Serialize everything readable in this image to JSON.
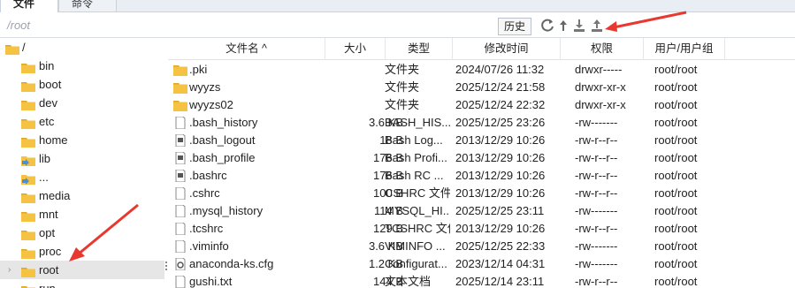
{
  "tabs": [
    {
      "label": "文件"
    },
    {
      "label": "命令"
    }
  ],
  "path": {
    "value": "/root"
  },
  "toolbar": {
    "history_label": "历史"
  },
  "tree": {
    "root": "/",
    "items": [
      {
        "label": "bin"
      },
      {
        "label": "boot"
      },
      {
        "label": "dev"
      },
      {
        "label": "etc"
      },
      {
        "label": "home"
      },
      {
        "label": "lib"
      },
      {
        "label": "..."
      },
      {
        "label": "media"
      },
      {
        "label": "mnt"
      },
      {
        "label": "opt"
      },
      {
        "label": "proc"
      },
      {
        "label": "root"
      },
      {
        "label": "run"
      }
    ],
    "selected": "root"
  },
  "table": {
    "columns": [
      "文件名 ^",
      "大小",
      "类型",
      "修改时间",
      "权限",
      "用户/用户组"
    ],
    "rows": [
      {
        "name": ".pki",
        "size": "",
        "type": "文件夹",
        "date": "2024/07/26 11:32",
        "perm": "drwxr-----",
        "owner": "root/root",
        "icon": "folder"
      },
      {
        "name": "wyyzs",
        "size": "",
        "type": "文件夹",
        "date": "2025/12/24 21:58",
        "perm": "drwxr-xr-x",
        "owner": "root/root",
        "icon": "folder"
      },
      {
        "name": "wyyzs02",
        "size": "",
        "type": "文件夹",
        "date": "2025/12/24 22:32",
        "perm": "drwxr-xr-x",
        "owner": "root/root",
        "icon": "folder"
      },
      {
        "name": ".bash_history",
        "size": "3.6 KB",
        "type": "BASH_HIS...",
        "date": "2025/12/25 23:26",
        "perm": "-rw-------",
        "owner": "root/root",
        "icon": "file"
      },
      {
        "name": ".bash_logout",
        "size": "18 B",
        "type": "Bash Log...",
        "date": "2013/12/29 10:26",
        "perm": "-rw-r--r--",
        "owner": "root/root",
        "icon": "doc"
      },
      {
        "name": ".bash_profile",
        "size": "176 B",
        "type": "Bash Profi...",
        "date": "2013/12/29 10:26",
        "perm": "-rw-r--r--",
        "owner": "root/root",
        "icon": "doc"
      },
      {
        "name": ".bashrc",
        "size": "176 B",
        "type": "Bash RC ...",
        "date": "2013/12/29 10:26",
        "perm": "-rw-r--r--",
        "owner": "root/root",
        "icon": "doc"
      },
      {
        "name": ".cshrc",
        "size": "100 B",
        "type": "CSHRC 文件",
        "date": "2013/12/29 10:26",
        "perm": "-rw-r--r--",
        "owner": "root/root",
        "icon": "file"
      },
      {
        "name": ".mysql_history",
        "size": "114 B",
        "type": "MYSQL_HI...",
        "date": "2025/12/25 23:11",
        "perm": "-rw-------",
        "owner": "root/root",
        "icon": "file"
      },
      {
        "name": ".tcshrc",
        "size": "129 B",
        "type": "TCSHRC 文件",
        "date": "2013/12/29 10:26",
        "perm": "-rw-r--r--",
        "owner": "root/root",
        "icon": "file"
      },
      {
        "name": ".viminfo",
        "size": "3.6 KB",
        "type": "VIMINFO ...",
        "date": "2025/12/25 22:33",
        "perm": "-rw-------",
        "owner": "root/root",
        "icon": "file"
      },
      {
        "name": "anaconda-ks.cfg",
        "size": "1.2 KB",
        "type": "Configurat...",
        "date": "2023/12/14 04:31",
        "perm": "-rw-------",
        "owner": "root/root",
        "icon": "gear"
      },
      {
        "name": "gushi.txt",
        "size": "144 B",
        "type": "文本文档",
        "date": "2025/12/14 23:11",
        "perm": "-rw-r--r--",
        "owner": "root/root",
        "icon": "file"
      }
    ]
  },
  "colors": {
    "folder": "#f5c242",
    "arrow": "#e8382f",
    "selected_row": "#e6e6e6"
  }
}
